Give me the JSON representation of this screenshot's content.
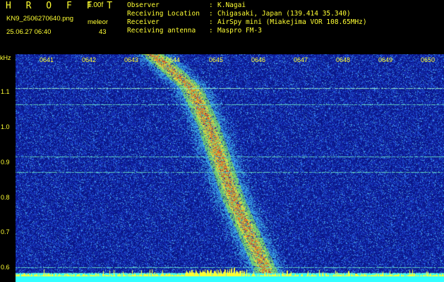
{
  "app": {
    "title": "H R O F F T",
    "version": "1.00f"
  },
  "file": {
    "name": "KN9_2506270640.png",
    "timestamp": "25.06.27 06:40"
  },
  "meteor": {
    "label": "meleor",
    "count": "43"
  },
  "info": [
    {
      "key": "Observer",
      "sep": ":",
      "value": "K.Nagai"
    },
    {
      "key": "Receiving Location",
      "sep": ":",
      "value": "Chigasaki, Japan (139.414 35.340)"
    },
    {
      "key": "Receiver",
      "sep": ":",
      "value": "AirSpy mini (Miakejima VOR 108.65MHz)"
    },
    {
      "key": "Receiving antenna",
      "sep": ":",
      "value": "Maspro FM-3"
    }
  ],
  "axes": {
    "y_unit": "kHz",
    "y_ticks": [
      "1.1",
      "1.0",
      "0.9",
      "0.8",
      "0.7",
      "0.6"
    ],
    "x_ticks": [
      "0641",
      "0642",
      "0643",
      "0644",
      "0645",
      "0646",
      "0647",
      "0648",
      "0649",
      "0650"
    ]
  },
  "colors": {
    "label": "#ffff33",
    "background": "#000000",
    "noise_floor": "#0a1a8a",
    "signal_hot": "#ff3300",
    "baseline": "#33ffff"
  },
  "chart_data": {
    "type": "heatmap",
    "xlabel": "",
    "ylabel": "kHz",
    "x_ticks": [
      "0641",
      "0642",
      "0643",
      "0644",
      "0645",
      "0646",
      "0647",
      "0648",
      "0649",
      "0650"
    ],
    "y_ticks": [
      1.1,
      1.0,
      0.9,
      0.8,
      0.7,
      0.6
    ],
    "ylim": [
      0.58,
      1.19
    ],
    "x_range_minutes": [
      "06:40",
      "06:50"
    ],
    "horizontal_lines_khz": [
      1.1,
      1.055,
      0.917,
      0.875,
      0.62,
      0.605
    ],
    "drift_trace": [
      {
        "time": "06:43.5",
        "khz": 1.19
      },
      {
        "time": "06:44.4",
        "khz": 1.1
      },
      {
        "time": "06:44.8",
        "khz": 1.0
      },
      {
        "time": "06:45.1",
        "khz": 0.9
      },
      {
        "time": "06:45.4",
        "khz": 0.8
      },
      {
        "time": "06:45.8",
        "khz": 0.7
      },
      {
        "time": "06:46.2",
        "khz": 0.6
      }
    ]
  }
}
